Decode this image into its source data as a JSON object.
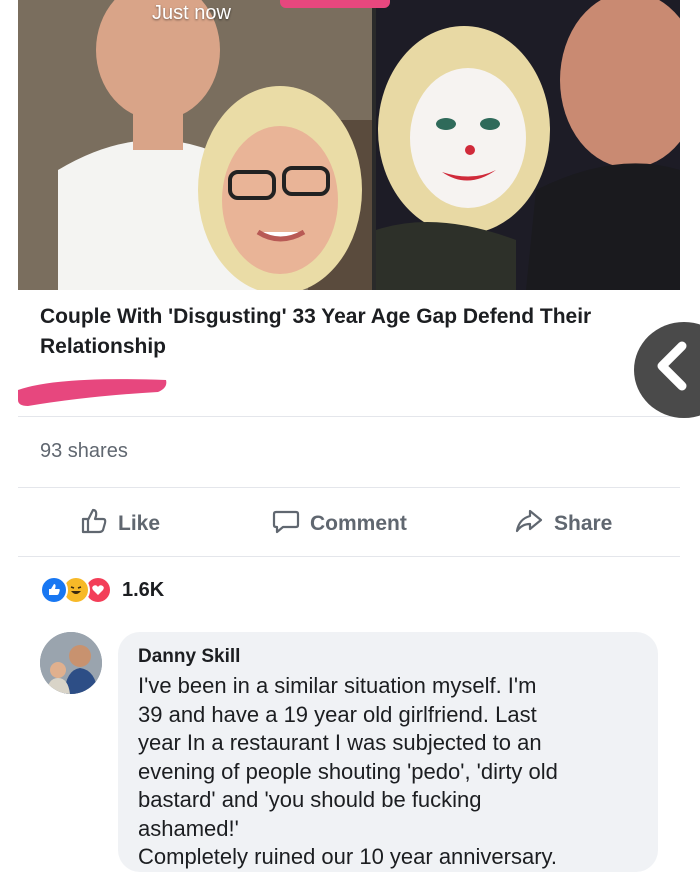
{
  "post": {
    "timestamp": "Just now",
    "link_title": "Couple With 'Disgusting' 33 Year Age Gap Defend Their Relationship",
    "shares": "93 shares",
    "actions": {
      "like": "Like",
      "comment": "Comment",
      "share": "Share"
    },
    "reaction_count": "1.6K",
    "reactions": [
      "like",
      "haha",
      "love"
    ]
  },
  "comment": {
    "author": "Danny Skill",
    "text": "I've been in a similar situation  myself. I'm\n39 and have a 19 year old girlfriend. Last\nyear In a restaurant I was subjected to an\nevening of people shouting 'pedo', 'dirty old\nbastard' and 'you should be fucking\nashamed!'\nCompletely ruined our 10 year anniversary."
  },
  "colors": {
    "like_blue": "#1877f2",
    "haha_yellow": "#f7b928",
    "love_red": "#f33e58",
    "scribble_pink": "#e7477e",
    "muted_text": "#606770"
  },
  "icons": [
    "thumbs-up-icon",
    "comment-bubble-icon",
    "share-arrow-icon",
    "back-chevron-icon"
  ]
}
